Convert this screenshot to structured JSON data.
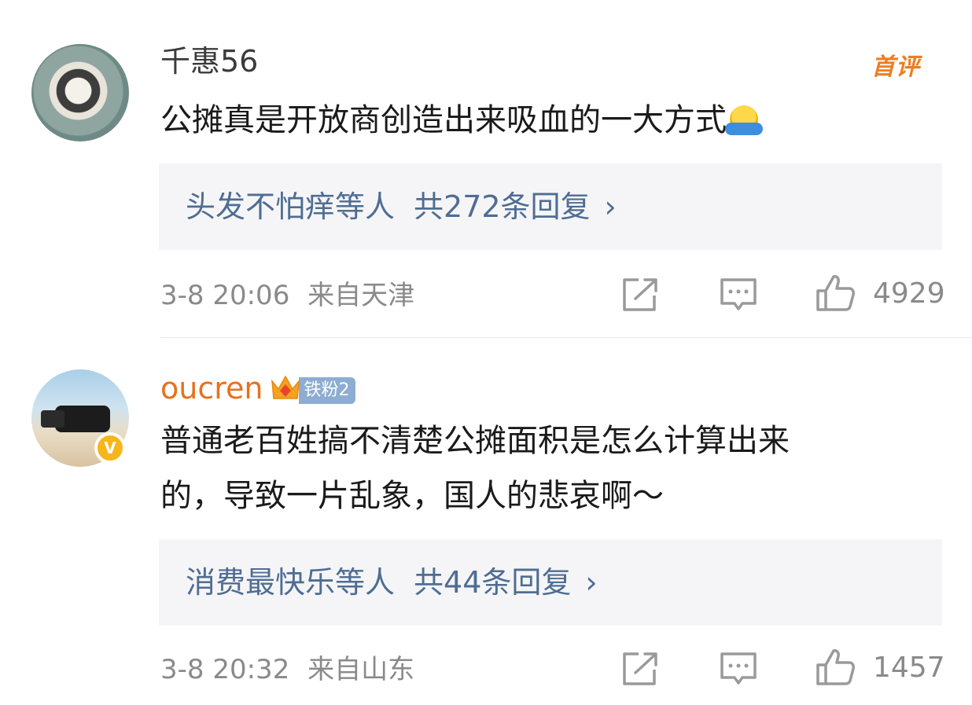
{
  "comments": [
    {
      "username": "千惠56",
      "badge": "首评",
      "text": "公摊真是开放商创造出来吸血的一大方式",
      "emoji": "shrug-emoji",
      "replies": {
        "names": "头发不怕痒等人",
        "count": "共272条回复",
        "chevron": "›"
      },
      "time": "3-8 20:06",
      "location": "来自天津",
      "likes": "4929"
    },
    {
      "username": "oucren",
      "fan_tag": "铁粉2",
      "verified": "V",
      "text_line1": "普通老百姓搞不清楚公摊面积是怎么计算出来",
      "text_line2": "的，导致一片乱象，国人的悲哀啊～",
      "replies": {
        "names": "消费最快乐等人",
        "count": "共44条回复",
        "chevron": "›"
      },
      "time": "3-8 20:32",
      "location": "来自山东",
      "likes": "1457"
    }
  ],
  "colors": {
    "username_default": "#3b3b3b",
    "username_vip": "#e8711c",
    "reply_link": "#4f6d93",
    "reply_bg": "#f5f5f7",
    "meta": "#8a8a8a",
    "first_badge": "#ee7d22",
    "fan_tag_bg": "#8dadd3"
  }
}
